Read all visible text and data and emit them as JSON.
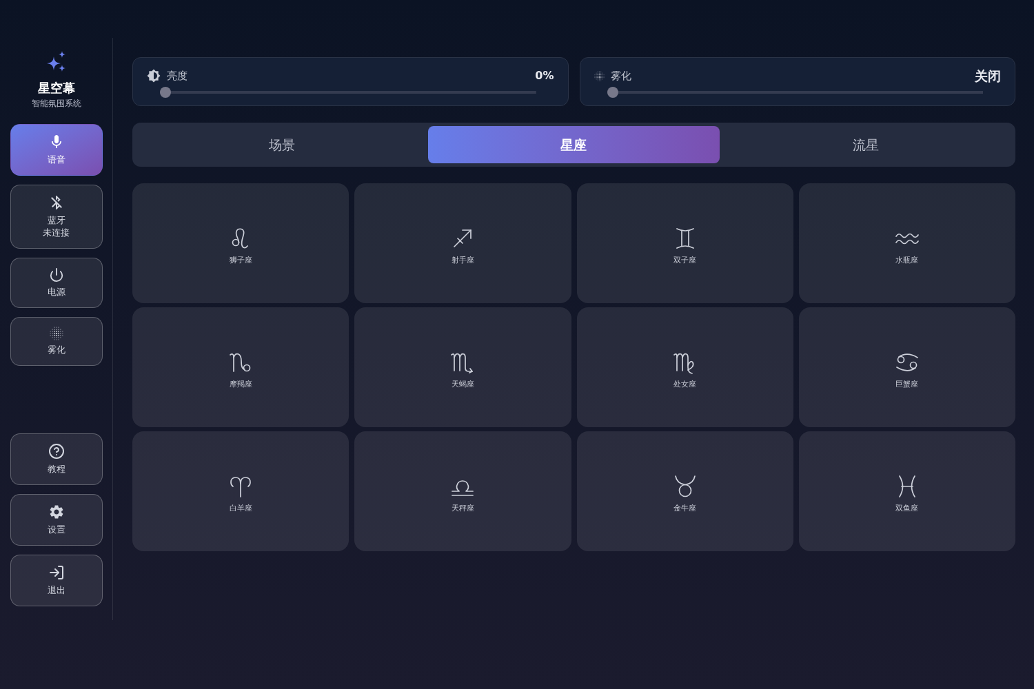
{
  "brand": {
    "title": "星空幕",
    "subtitle": "智能氛围系统"
  },
  "sidebar": {
    "items": [
      {
        "label": "语音",
        "active": true
      },
      {
        "label": "蓝牙",
        "status": "未连接",
        "active": false
      },
      {
        "label": "电源",
        "active": false
      },
      {
        "label": "雾化",
        "active": false
      }
    ],
    "bottom_items": [
      {
        "label": "教程"
      },
      {
        "label": "设置"
      },
      {
        "label": "退出"
      }
    ]
  },
  "controls": [
    {
      "label": "亮度",
      "reading": "0%",
      "level": 0
    },
    {
      "label": "雾化",
      "reading": "关闭",
      "level": 0
    }
  ],
  "tabs": [
    {
      "label": "场景",
      "selected": false
    },
    {
      "label": "星座",
      "selected": true
    },
    {
      "label": "流星",
      "selected": false
    }
  ],
  "constellations": [
    {
      "label": "狮子座"
    },
    {
      "label": "射手座"
    },
    {
      "label": "双子座"
    },
    {
      "label": "水瓶座"
    },
    {
      "label": "摩羯座"
    },
    {
      "label": "天蝎座"
    },
    {
      "label": "处女座"
    },
    {
      "label": "巨蟹座"
    },
    {
      "label": "白羊座"
    },
    {
      "label": "天秤座"
    },
    {
      "label": "金牛座"
    },
    {
      "label": "双鱼座"
    }
  ]
}
